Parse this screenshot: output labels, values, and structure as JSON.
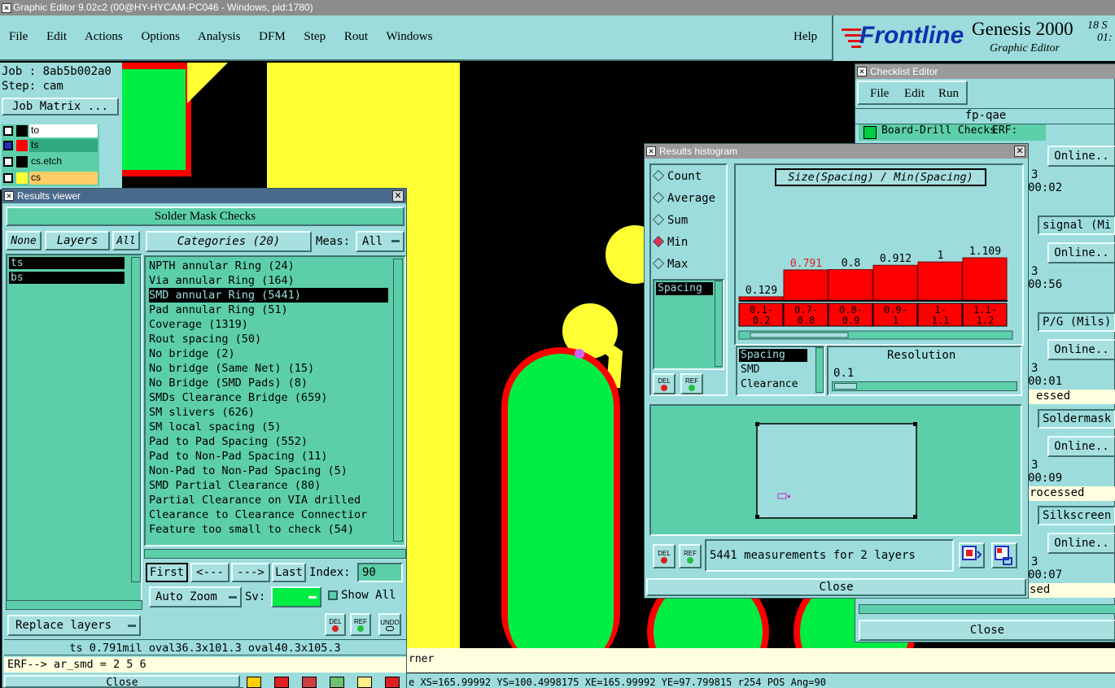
{
  "app": {
    "title": "Graphic Editor 9.02c2 (00@HY-HYCAM-PC046 - Windows, pid:1780)"
  },
  "menubar": {
    "items": [
      "File",
      "Edit",
      "Actions",
      "Options",
      "Analysis",
      "DFM",
      "Step",
      "Rout",
      "Windows"
    ],
    "help": "Help"
  },
  "brand": {
    "logo": "Frontline",
    "product": "Genesis 2000",
    "sub": "Graphic Editor",
    "clock1": "18  S",
    "clock2": "01:"
  },
  "job": {
    "job": "Job : 8ab5b002a0",
    "step": "Step: cam",
    "matrix": "Job Matrix ..."
  },
  "layers": [
    {
      "name": "to",
      "color": "#000000"
    },
    {
      "name": "ts",
      "color": "#ff0000"
    },
    {
      "name": "cs.etch",
      "color": "#000000"
    },
    {
      "name": "cs",
      "color": "#ffcc66"
    }
  ],
  "results_viewer": {
    "title": "Results viewer",
    "header": "Solder Mask Checks",
    "none": "None",
    "layers": "Layers",
    "all": "All",
    "layer_list": [
      "ts",
      "bs"
    ],
    "categories_label": "Categories (20)",
    "meas_label": "Meas:",
    "meas_value": "All",
    "categories": [
      "NPTH annular Ring (24)",
      "Via annular Ring (164)",
      "SMD annular Ring (5441)",
      "Pad annular Ring (51)",
      "Coverage (1319)",
      "Rout spacing (50)",
      "No bridge (2)",
      "No bridge (Same Net) (15)",
      "No Bridge (SMD Pads) (8)",
      "SMDs Clearance Bridge (659)",
      "SM slivers (626)",
      "SM local spacing (5)",
      "Pad to Pad Spacing (552)",
      "Pad to Non-Pad Spacing (11)",
      "Non-Pad to Non-Pad Spacing (5)",
      "SMD Partial Clearance (80)",
      "Partial Clearance on VIA drilled",
      "Clearance to Clearance Connectior",
      "Feature too small to check (54)"
    ],
    "first": "First",
    "prev": "<---",
    "next": "--->",
    "last": "Last",
    "index_label": "Index:",
    "index_value": "90",
    "auto_zoom": "Auto Zoom",
    "sv": "Sv:",
    "show_all": "Show All",
    "replace_layers": "Replace layers",
    "del": "DEL",
    "ref": "REF",
    "undo": "UNDO",
    "status": "ts 0.791mil   oval36.3x101.3   oval40.3x105.3",
    "erf": "ERF--> ar_smd = 2 5 6",
    "close": "Close"
  },
  "histogram": {
    "title": "Results histogram",
    "options": [
      "Count",
      "Average",
      "Sum",
      "Min",
      "Max"
    ],
    "selected_option": "Min",
    "param_list": [
      "Spacing"
    ],
    "chart_title": "Size(Spacing) / Min(Spacing)",
    "measure_list": [
      "Spacing",
      "SMD",
      "Clearance"
    ],
    "resolution_label": "Resolution",
    "resolution_value": "0.1",
    "measurements": "5441 measurements for 2 layers",
    "del": "DEL",
    "ref": "REF",
    "close": "Close"
  },
  "chart_data": {
    "type": "bar",
    "title": "Size(Spacing) / Min(Spacing)",
    "categories": [
      "0.1-0.2",
      "0.7-0.8",
      "0.8-0.9",
      "0.9-1",
      "1-1.1",
      "1.1-1.2"
    ],
    "values": [
      0.129,
      0.791,
      0.8,
      0.912,
      1,
      1.109
    ],
    "value_labels": [
      "0.129",
      "0.791",
      "0.8",
      "0.912",
      "1",
      "1.109"
    ],
    "range_labels_top": [
      "0.1-",
      "0.7-",
      "0.8-",
      "0.9-",
      "1-",
      "1.1-"
    ],
    "range_labels_bottom": [
      "0.2",
      "0.8",
      "0.9",
      "1",
      "1.1",
      "1.2"
    ],
    "highlight_index": 1,
    "bar_color": "#ff0000"
  },
  "checklist": {
    "title": "Checklist Editor",
    "menu": [
      "File",
      "Edit",
      "Run"
    ],
    "name": "fp-qae",
    "rows": [
      {
        "label": "Board-Drill Checks",
        "erf": "ERF:",
        "online": "Online..",
        "num": "3",
        "time": "00:02"
      },
      {
        "label": "signal (Mi",
        "online": "Online..",
        "num": "3",
        "time": "00:56"
      },
      {
        "label": "P/G (Mils)",
        "online": "Online..",
        "num": "3",
        "time": "00:01",
        "state": "essed"
      },
      {
        "label": "Soldermask",
        "online": "Online..",
        "num": "3",
        "time": "00:09",
        "state": "rocessed"
      },
      {
        "label": "Silkscreen",
        "online": "Online..",
        "num": "3",
        "time": "00:07",
        "state": "sed"
      }
    ],
    "close": "Close"
  },
  "bottom": {
    "prompt": "rner",
    "coords": "e XS=165.99992 YS=100.4998175 XE=165.99992 YE=97.799815 r254 POS Ang=90"
  }
}
